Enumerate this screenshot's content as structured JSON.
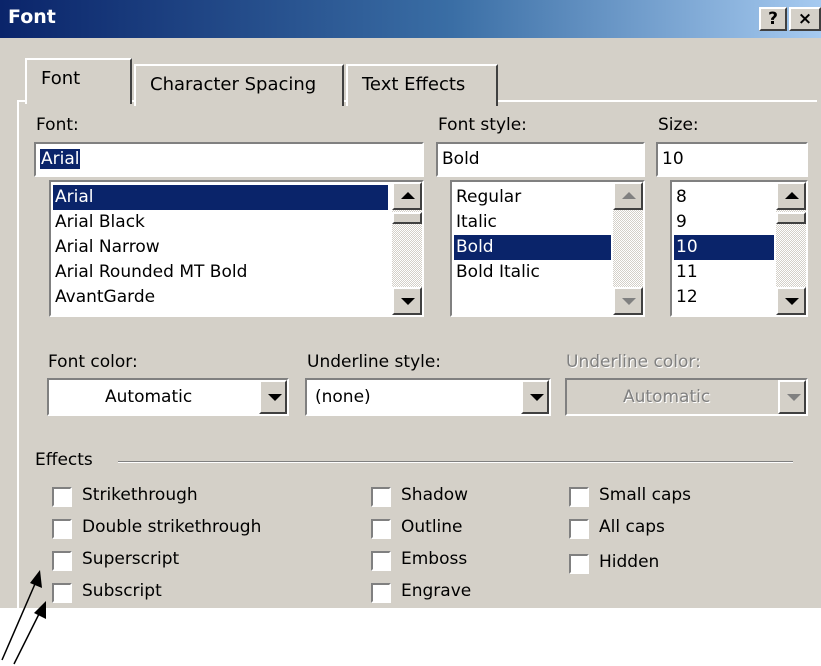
{
  "window": {
    "title": "Font",
    "help_button": "?",
    "close_button": "×"
  },
  "tabs": [
    {
      "label": "Font"
    },
    {
      "label": "Character Spacing"
    },
    {
      "label": "Text Effects"
    }
  ],
  "font": {
    "label": "Font:",
    "value": "Arial",
    "items": [
      "Arial",
      "Arial Black",
      "Arial Narrow",
      "Arial Rounded MT Bold",
      "AvantGarde"
    ],
    "selected": "Arial"
  },
  "font_style": {
    "label": "Font style:",
    "value": "Bold",
    "items": [
      "Regular",
      "Italic",
      "Bold",
      "Bold Italic"
    ],
    "selected": "Bold"
  },
  "size": {
    "label": "Size:",
    "value": "10",
    "items": [
      "8",
      "9",
      "10",
      "11",
      "12"
    ],
    "selected": "10"
  },
  "font_color": {
    "label": "Font color:",
    "value": "Automatic"
  },
  "underline_style": {
    "label": "Underline style:",
    "value": "(none)"
  },
  "underline_color": {
    "label": "Underline color:",
    "value": "Automatic",
    "disabled": true
  },
  "effects": {
    "label": "Effects",
    "col1": [
      "Strikethrough",
      "Double strikethrough",
      "Superscript",
      "Subscript"
    ],
    "col2": [
      "Shadow",
      "Outline",
      "Emboss",
      "Engrave"
    ],
    "col3": [
      "Small caps",
      "All caps",
      "Hidden"
    ]
  },
  "colors": {
    "titlebar_start": "#0a246a",
    "titlebar_end": "#a6caf0",
    "dialog_face": "#d4d0c8",
    "selection": "#0a246a",
    "annotation_arrow": "#000000"
  }
}
